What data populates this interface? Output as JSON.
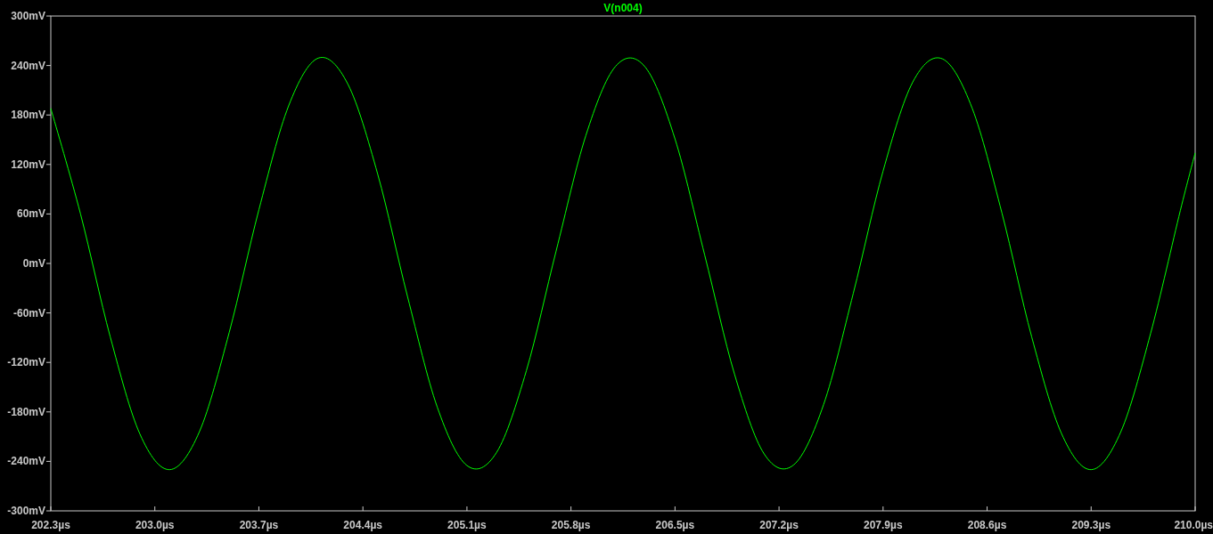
{
  "chart": {
    "chart_data": {
      "type": "line",
      "x": [
        202.3,
        202.5,
        202.7,
        202.9,
        203.1,
        203.3,
        203.5,
        203.7,
        203.9,
        204.1,
        204.3,
        204.5,
        204.7,
        204.9,
        205.1,
        205.3,
        205.5,
        205.7,
        205.9,
        206.1,
        206.3,
        206.5,
        206.7,
        206.9,
        207.1,
        207.3,
        207.5,
        207.7,
        207.9,
        208.1,
        208.3,
        208.5,
        208.7,
        208.9,
        209.1,
        209.3,
        209.5,
        209.7,
        209.9,
        210.0
      ],
      "series": [
        {
          "name": "V(n004)",
          "color": "#00ff00",
          "values": [
            188,
            60,
            -89,
            -207,
            -250,
            -204,
            -84,
            65,
            191,
            249,
            217,
            108,
            -40,
            -174,
            -245,
            -229,
            -130,
            15,
            155,
            239,
            238,
            151,
            10,
            -134,
            -231,
            -244,
            -171,
            -36,
            112,
            220,
            248,
            188,
            61,
            -89,
            -206,
            -250,
            -204,
            -85,
            64,
            134
          ]
        }
      ],
      "xlim": [
        202.3,
        210.0
      ],
      "ylim": [
        -300,
        300
      ],
      "xticks": [
        {
          "value": 202.3,
          "label": "202.3µs"
        },
        {
          "value": 203.0,
          "label": "203.0µs"
        },
        {
          "value": 203.7,
          "label": "203.7µs"
        },
        {
          "value": 204.4,
          "label": "204.4µs"
        },
        {
          "value": 205.1,
          "label": "205.1µs"
        },
        {
          "value": 205.8,
          "label": "205.8µs"
        },
        {
          "value": 206.5,
          "label": "206.5µs"
        },
        {
          "value": 207.2,
          "label": "207.2µs"
        },
        {
          "value": 207.9,
          "label": "207.9µs"
        },
        {
          "value": 208.6,
          "label": "208.6µs"
        },
        {
          "value": 209.3,
          "label": "209.3µs"
        },
        {
          "value": 210.0,
          "label": "210.0µs"
        }
      ],
      "yticks": [
        {
          "value": 300,
          "label": "300mV"
        },
        {
          "value": 240,
          "label": "240mV"
        },
        {
          "value": 180,
          "label": "180mV"
        },
        {
          "value": 120,
          "label": "120mV"
        },
        {
          "value": 60,
          "label": "60mV"
        },
        {
          "value": 0,
          "label": "0mV"
        },
        {
          "value": -60,
          "label": "-60mV"
        },
        {
          "value": -120,
          "label": "-120mV"
        },
        {
          "value": -180,
          "label": "-180mV"
        },
        {
          "value": -240,
          "label": "-240mV"
        },
        {
          "value": -300,
          "label": "-300mV"
        }
      ]
    }
  }
}
